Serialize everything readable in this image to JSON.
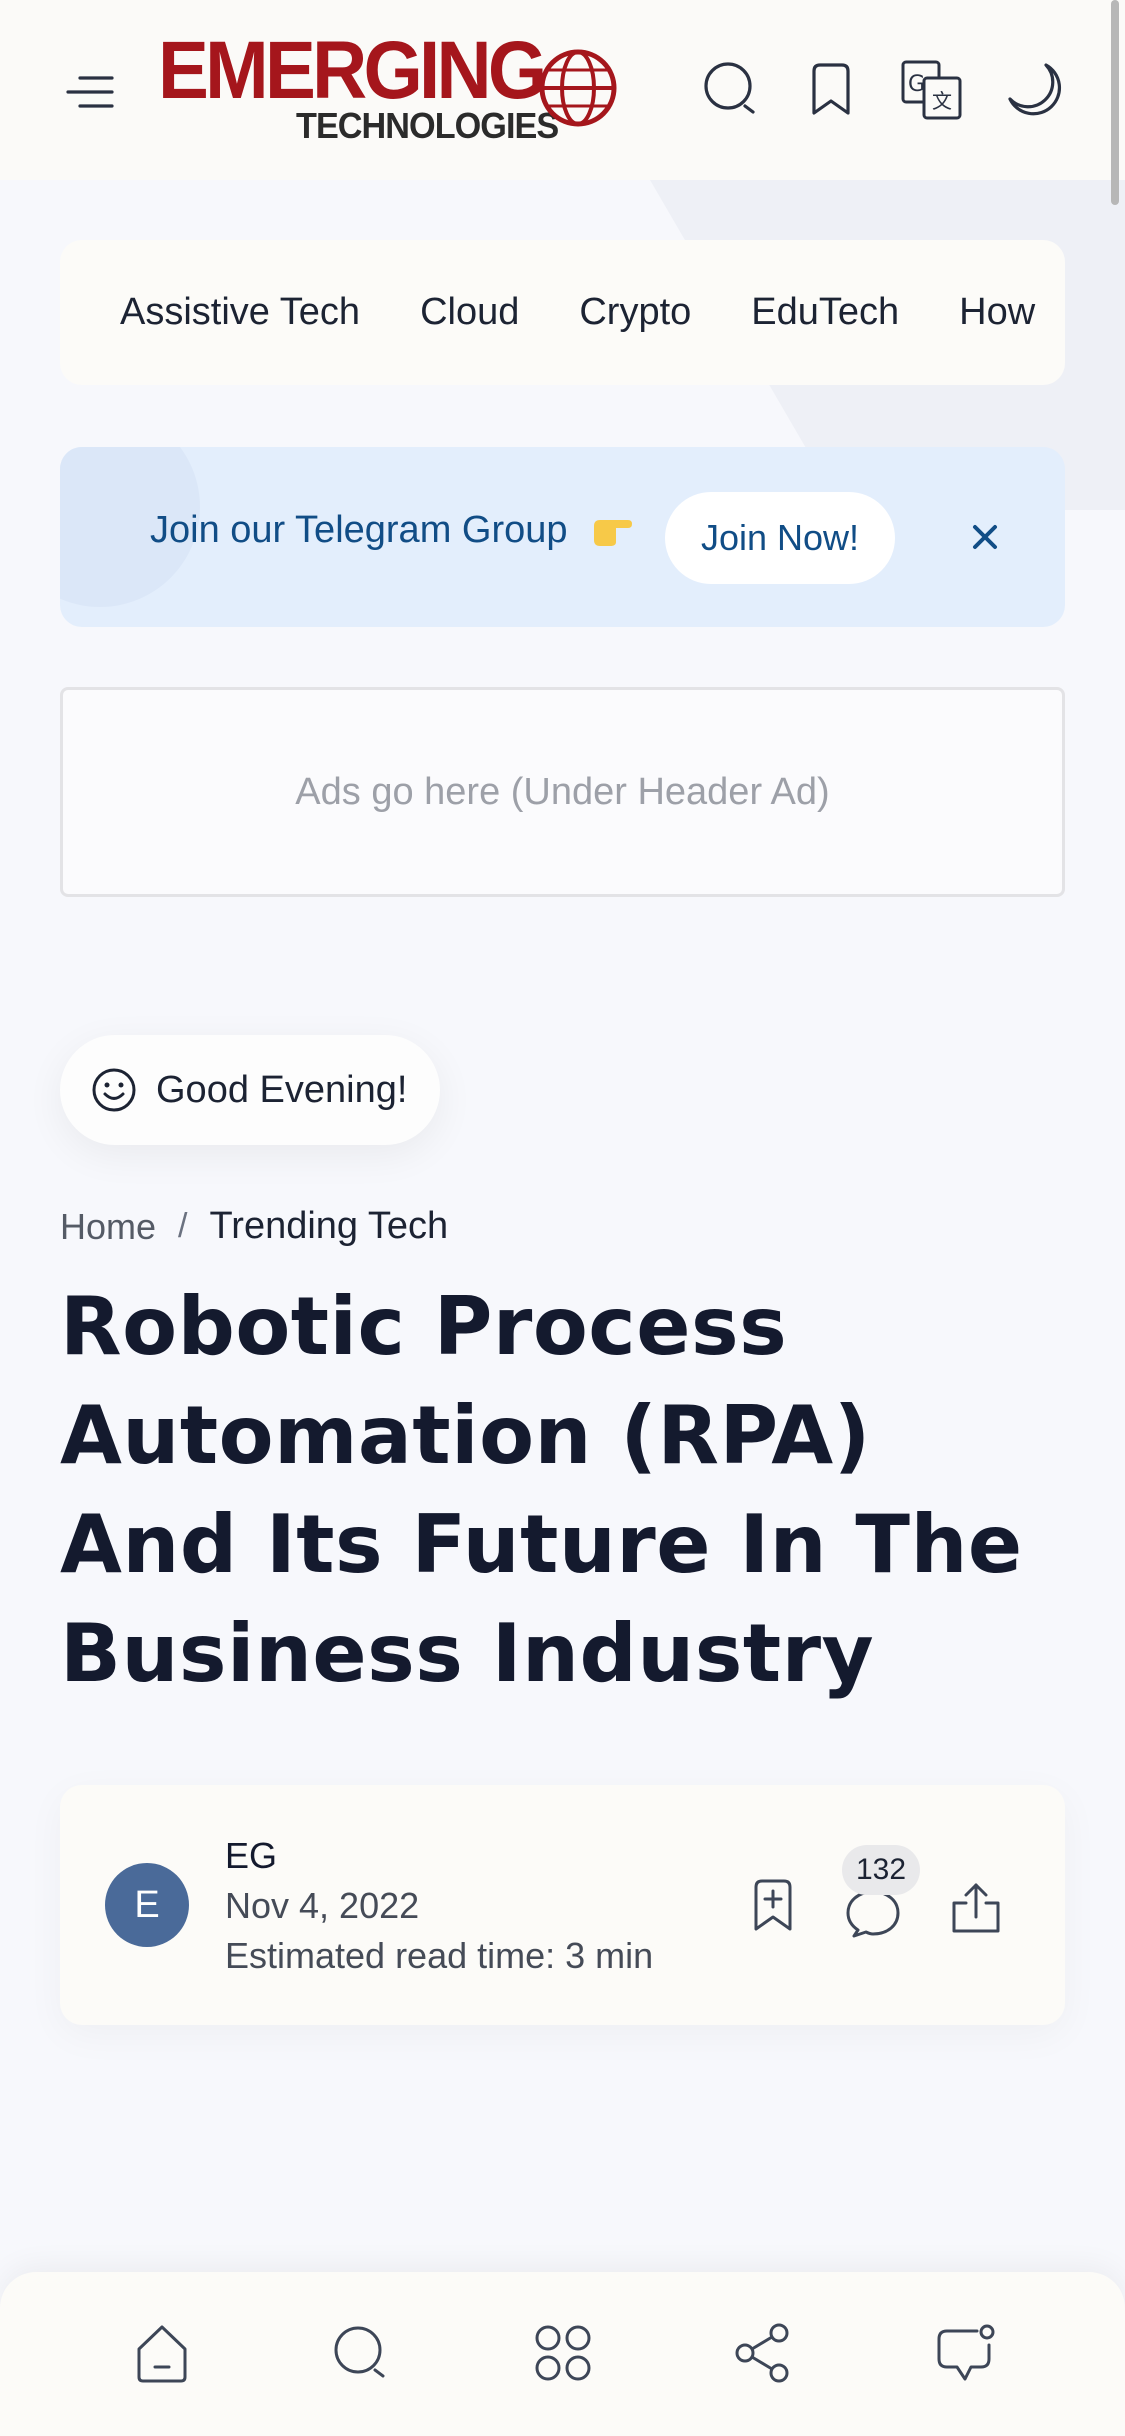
{
  "header": {
    "logo_main": "EMERGING",
    "logo_sub": "TECHNOLOGIES",
    "icons": [
      "menu-icon",
      "search-icon",
      "bookmark-icon",
      "translate-icon",
      "moon-icon"
    ]
  },
  "categories": [
    "Assistive Tech",
    "Cloud",
    "Crypto",
    "EduTech",
    "How"
  ],
  "telegram_banner": {
    "text": "Join our Telegram Group",
    "emoji": "pointing-hand-icon",
    "button_label": "Join Now!",
    "close_icon": "close-icon"
  },
  "ad": {
    "text": "Ads go here (Under Header Ad)"
  },
  "greeting": {
    "text": "Good Evening!",
    "icon": "smiley-icon"
  },
  "breadcrumb": {
    "home": "Home",
    "separator": "/",
    "current": "Trending Tech"
  },
  "article": {
    "title": "Robotic Process Automation (RPA) And Its Future In The Business Industry"
  },
  "author": {
    "avatar_letter": "E",
    "name": "EG",
    "date": "Nov 4, 2022",
    "read_time": "Estimated read time: 3 min",
    "comment_count": "132"
  },
  "bottom_nav": [
    "home-icon",
    "search-icon",
    "categories-icon",
    "share-icon",
    "chat-icon"
  ],
  "colors": {
    "brand_red": "#a5161c",
    "link_blue": "#114d86",
    "banner_bg": "#e3eefc",
    "text_dark": "#141a2e",
    "avatar_blue": "#4a6a99"
  }
}
